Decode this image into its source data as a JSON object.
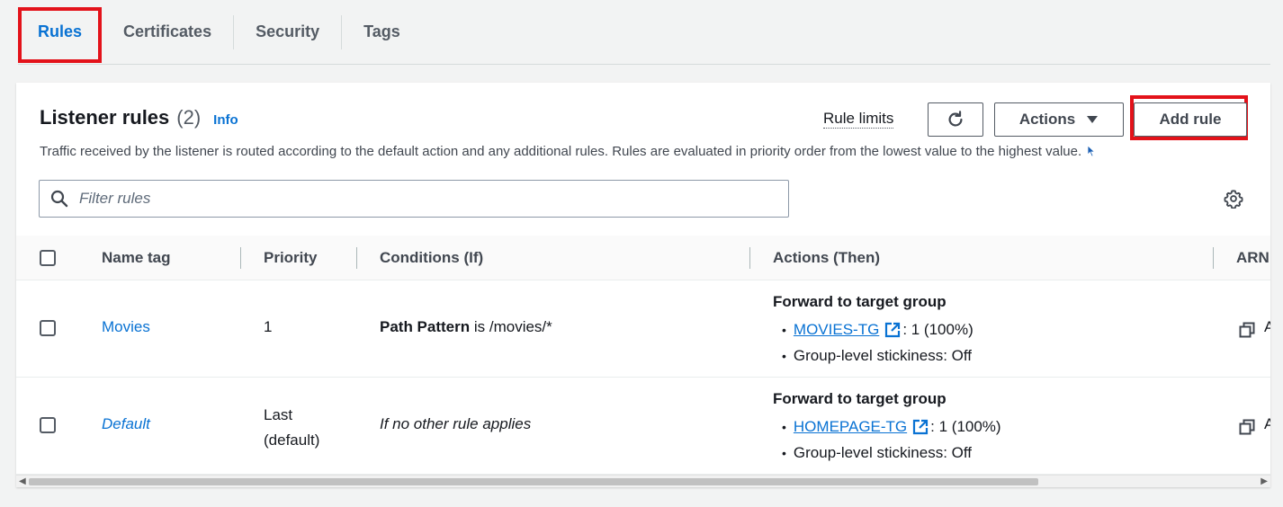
{
  "tabs": [
    {
      "label": "Rules",
      "active": true
    },
    {
      "label": "Certificates"
    },
    {
      "label": "Security"
    },
    {
      "label": "Tags"
    }
  ],
  "panel": {
    "title": "Listener rules",
    "count": "(2)",
    "info": "Info",
    "description": "Traffic received by the listener is routed according to the default action and any additional rules. Rules are evaluated in priority order from the lowest value to the highest value.",
    "rule_limits": "Rule limits",
    "actions_label": "Actions",
    "add_rule_label": "Add rule",
    "search_placeholder": "Filter rules"
  },
  "table": {
    "headers": {
      "name": "Name tag",
      "priority": "Priority",
      "conditions": "Conditions (If)",
      "actions": "Actions (Then)",
      "arn": "ARN"
    },
    "rows": [
      {
        "name": "Movies",
        "priority": "1",
        "condition_bold": "Path Pattern",
        "condition_rest": " is /movies/*",
        "action_title": "Forward to target group",
        "target": "MOVIES-TG",
        "weight": ": 1 (100%)",
        "stickiness": "Group-level stickiness: Off",
        "arn_prefix": "A"
      },
      {
        "name": "Default",
        "priority_line1": "Last",
        "priority_line2": "(default)",
        "condition": "If no other rule applies",
        "action_title": "Forward to target group",
        "target": "HOMEPAGE-TG",
        "weight": ": 1 (100%)",
        "stickiness": "Group-level stickiness: Off",
        "arn_prefix": "A"
      }
    ]
  },
  "colors": {
    "accent": "#0972d3",
    "highlight": "#e3121a",
    "background": "#f2f3f3"
  }
}
